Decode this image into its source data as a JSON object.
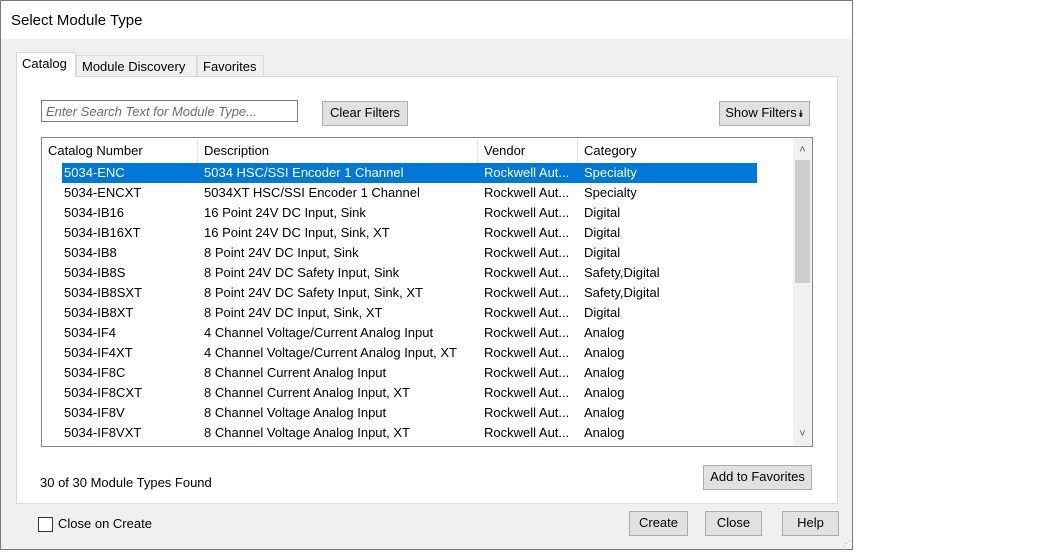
{
  "window": {
    "title": "Select Module Type"
  },
  "tabs": [
    {
      "label": "Catalog",
      "active": true
    },
    {
      "label": "Module Discovery",
      "active": false
    },
    {
      "label": "Favorites",
      "active": false
    }
  ],
  "search": {
    "placeholder": "Enter Search Text for Module Type...",
    "value": ""
  },
  "buttons": {
    "clear_filters": "Clear Filters",
    "show_filters": "Show Filters",
    "add_to_favorites": "Add to Favorites",
    "create": "Create",
    "close": "Close",
    "help": "Help"
  },
  "table": {
    "columns": [
      "Catalog Number",
      "Description",
      "Vendor",
      "Category"
    ],
    "selected_index": 0,
    "rows": [
      [
        "5034-ENC",
        "5034 HSC/SSI Encoder 1 Channel",
        "Rockwell Aut...",
        "Specialty"
      ],
      [
        "5034-ENCXT",
        "5034XT HSC/SSI Encoder 1 Channel",
        "Rockwell Aut...",
        "Specialty"
      ],
      [
        "5034-IB16",
        "16 Point 24V DC Input, Sink",
        "Rockwell Aut...",
        "Digital"
      ],
      [
        "5034-IB16XT",
        "16 Point 24V DC Input, Sink, XT",
        "Rockwell Aut...",
        "Digital"
      ],
      [
        "5034-IB8",
        "8 Point 24V DC Input, Sink",
        "Rockwell Aut...",
        "Digital"
      ],
      [
        "5034-IB8S",
        "8 Point 24V DC Safety Input, Sink",
        "Rockwell Aut...",
        "Safety,Digital"
      ],
      [
        "5034-IB8SXT",
        "8 Point 24V DC Safety Input, Sink, XT",
        "Rockwell Aut...",
        "Safety,Digital"
      ],
      [
        "5034-IB8XT",
        "8 Point 24V DC Input, Sink, XT",
        "Rockwell Aut...",
        "Digital"
      ],
      [
        "5034-IF4",
        "4 Channel Voltage/Current Analog Input",
        "Rockwell Aut...",
        "Analog"
      ],
      [
        "5034-IF4XT",
        "4 Channel Voltage/Current Analog Input, XT",
        "Rockwell Aut...",
        "Analog"
      ],
      [
        "5034-IF8C",
        "8 Channel Current Analog Input",
        "Rockwell Aut...",
        "Analog"
      ],
      [
        "5034-IF8CXT",
        "8 Channel Current Analog Input, XT",
        "Rockwell Aut...",
        "Analog"
      ],
      [
        "5034-IF8V",
        "8 Channel Voltage Analog Input",
        "Rockwell Aut...",
        "Analog"
      ],
      [
        "5034-IF8VXT",
        "8 Channel Voltage Analog Input, XT",
        "Rockwell Aut...",
        "Analog"
      ]
    ]
  },
  "status": {
    "text": "30 of 30 Module Types Found"
  },
  "options": {
    "close_on_create_label": "Close on Create",
    "close_on_create_checked": false
  },
  "colors": {
    "selection": "#0078d7",
    "dialog_bg": "#f0f0f0"
  }
}
